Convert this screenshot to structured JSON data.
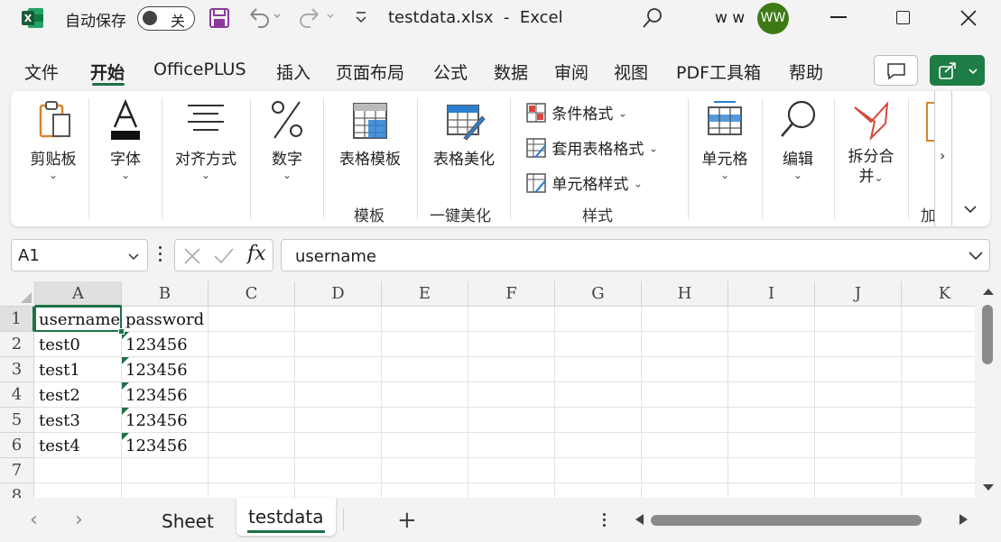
{
  "window": {
    "title": "testdata.xlsx  -  Excel",
    "autosave_label": "自动保存",
    "autosave_state": "关",
    "user_name": "w w",
    "user_initials": "WW"
  },
  "menu": [
    "文件",
    "开始",
    "OfficePLUS",
    "插入",
    "页面布局",
    "公式",
    "数据",
    "审阅",
    "视图",
    "PDF工具箱",
    "帮助"
  ],
  "menu_active": "开始",
  "ribbon": {
    "clipboard": "剪贴板",
    "font": "字体",
    "align": "对齐方式",
    "number": "数字",
    "table_template": "表格模板",
    "template_group": "模板",
    "table_beautify": "表格美化",
    "beautify_group": "一键美化",
    "conditional_format": "条件格式",
    "format_as_table": "套用表格格式",
    "cell_styles": "单元格样式",
    "style_group": "样式",
    "cells": "单元格",
    "editing": "编辑",
    "split_merge_1": "拆分合",
    "split_merge_2": "并",
    "addins_partial": "加"
  },
  "formula": {
    "name_box": "A1",
    "fx": "fx",
    "value": "username"
  },
  "columns": [
    "A",
    "B",
    "C",
    "D",
    "E",
    "F",
    "G",
    "H",
    "I",
    "J",
    "K"
  ],
  "rows": [
    "1",
    "2",
    "3",
    "4",
    "5",
    "6",
    "7",
    "8"
  ],
  "cells": {
    "A1": "username",
    "B1": "password",
    "A2": "test0",
    "B2": "123456",
    "A3": "test1",
    "B3": "123456",
    "A4": "test2",
    "B4": "123456",
    "A5": "test3",
    "B5": "123456",
    "A6": "test4",
    "B6": "123456"
  },
  "sheets": [
    "Sheet",
    "testdata"
  ],
  "active_sheet": "testdata",
  "colors": {
    "excel_green": "#1e7145",
    "avatar_green": "#3d7a16",
    "share_button": "#1d7d45"
  }
}
